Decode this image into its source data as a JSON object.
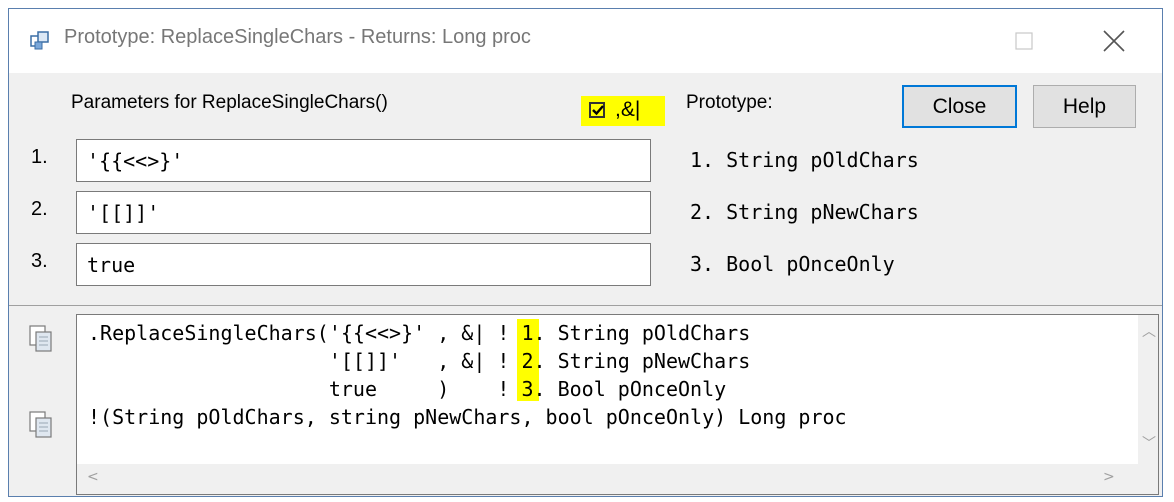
{
  "window": {
    "title": "Prototype: ReplaceSingleChars - Returns: Long proc",
    "icon": "prototype-app-icon"
  },
  "params": {
    "heading": "Parameters for ReplaceSingleChars()",
    "amp_toggle_label": ",&|",
    "amp_toggle_checked": true,
    "rows": [
      {
        "num": "1.",
        "value": "'{{<<>}'"
      },
      {
        "num": "2.",
        "value": "'[[]]'"
      },
      {
        "num": "3.",
        "value": "true"
      }
    ]
  },
  "prototype": {
    "heading": "Prototype:",
    "lines": [
      "1. String pOldChars",
      "2. String pNewChars",
      "3. Bool pOnceOnly"
    ]
  },
  "buttons": {
    "close": "Close",
    "help": "Help"
  },
  "code": {
    "lines": [
      ".ReplaceSingleChars('{{<<>}' , &| ! 1. String pOldChars",
      "                    '[[]]'   , &| ! 2. String pNewChars",
      "                    true     )    ! 3. Bool pOnceOnly",
      "!(String pOldChars, string pNewChars, bool pOnceOnly) Long proc"
    ]
  },
  "colors": {
    "highlight": "#ffff00",
    "focus": "#0078d7"
  }
}
